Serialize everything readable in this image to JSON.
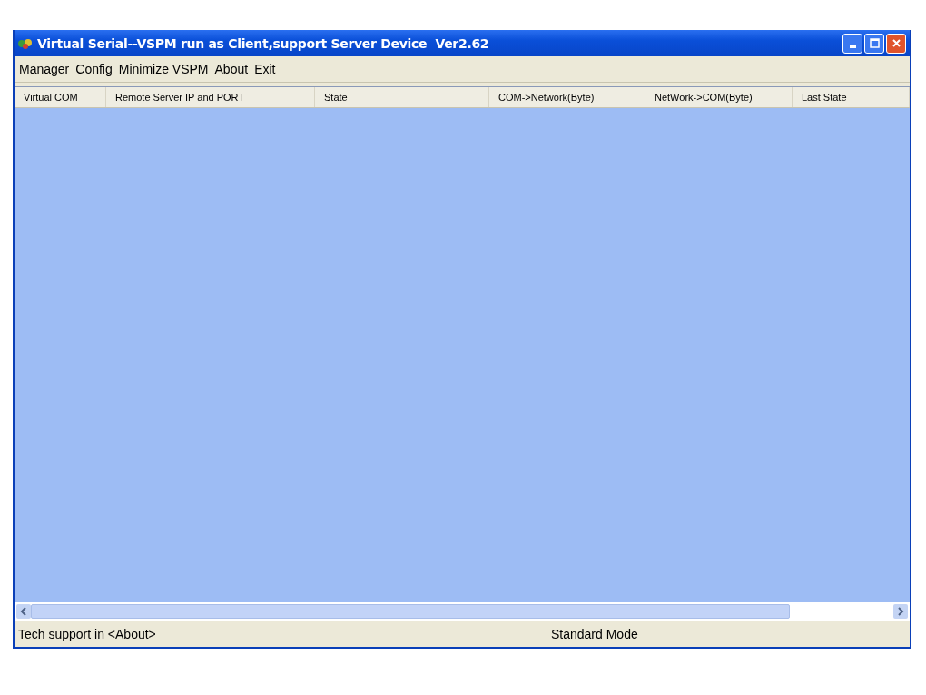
{
  "window": {
    "title": "Virtual Serial--VSPM run as Client,support Server Device  Ver2.62"
  },
  "menu": [
    "Manager",
    "Config",
    "Minimize VSPM",
    "About",
    "Exit"
  ],
  "table": {
    "columns": [
      "Virtual COM",
      "Remote Server IP and PORT",
      "State",
      "COM->Network(Byte)",
      "NetWork->COM(Byte)",
      "Last State"
    ]
  },
  "status_bar": [
    "Tech support in <About>",
    "Standard Mode"
  ]
}
